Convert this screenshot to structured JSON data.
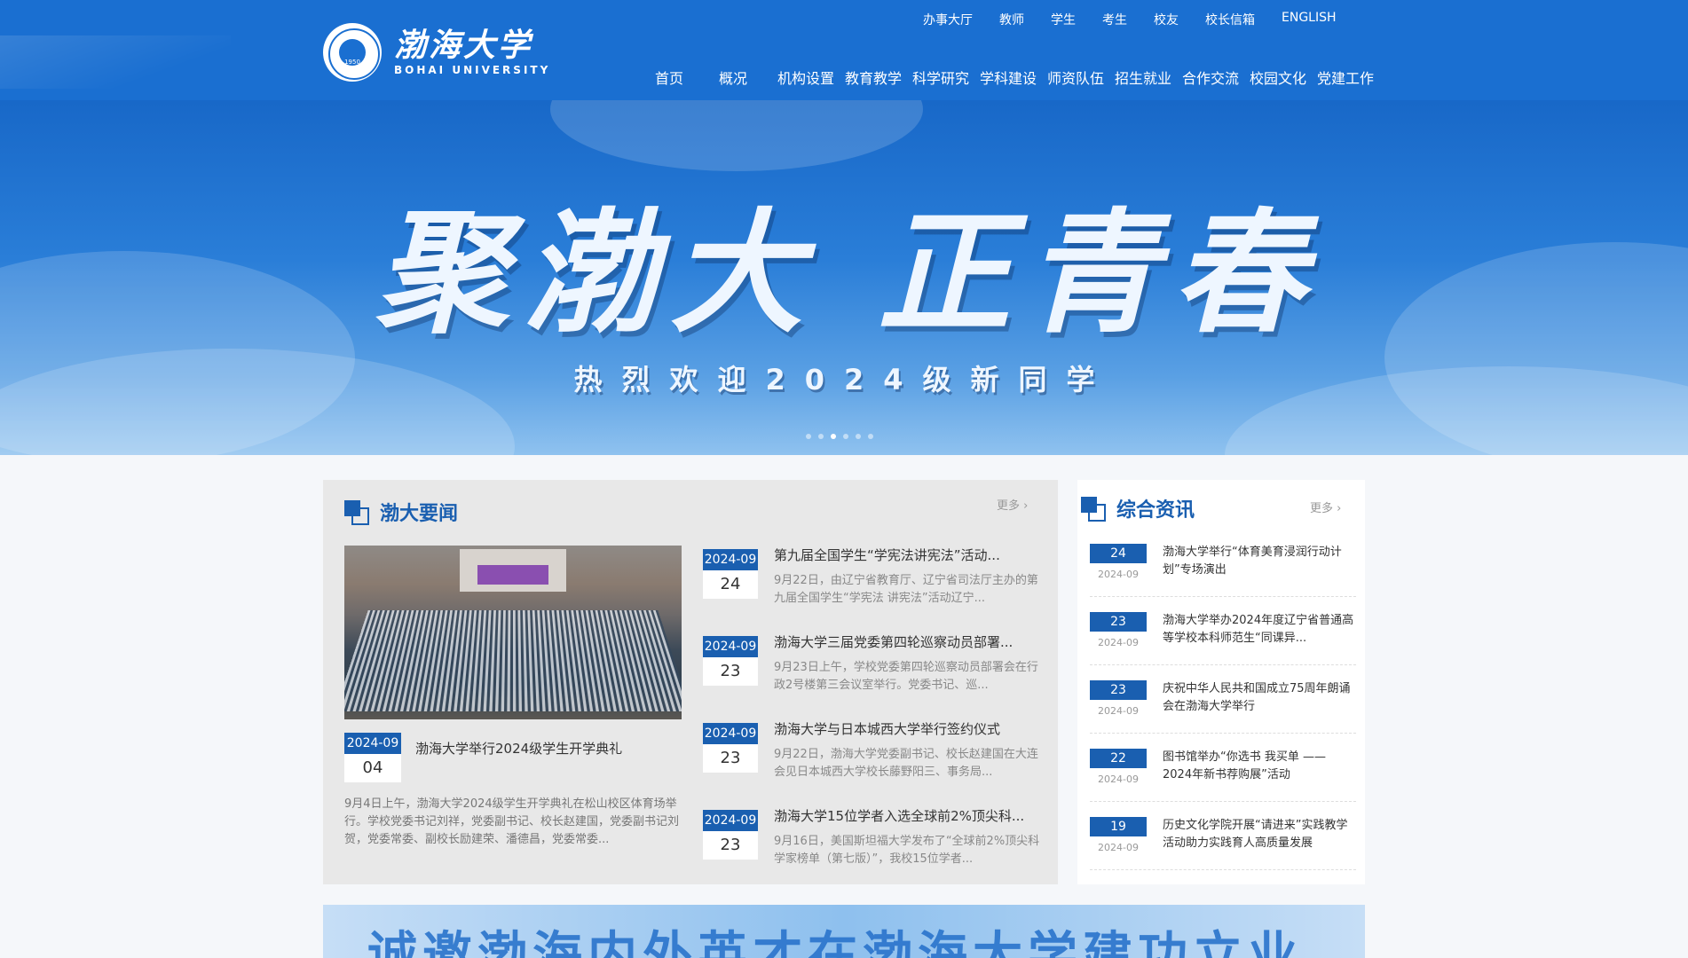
{
  "header": {
    "logo_cn": "渤海大学",
    "logo_en": "BOHAI UNIVERSITY",
    "seal_year": "1950",
    "top_links": [
      "办事大厅",
      "教师",
      "学生",
      "考生",
      "校友",
      "校长信箱",
      "ENGLISH"
    ],
    "main_nav": [
      "首页",
      "概况",
      "机构设置",
      "教育教学",
      "科学研究",
      "学科建设",
      "师资队伍",
      "招生就业",
      "合作交流",
      "校园文化",
      "党建工作"
    ]
  },
  "banner": {
    "title": "聚渤大 正青春",
    "subtitle": "热烈欢迎2024级新同学",
    "slides": 6,
    "active_slide": 3
  },
  "news": {
    "title": "渤大要闻",
    "more": "更多",
    "feature": {
      "date_ym": "2024-09",
      "date_d": "04",
      "title": "渤海大学举行2024级学生开学典礼",
      "desc": "9月4日上午，渤海大学2024级学生开学典礼在松山校区体育场举行。学校党委书记刘祥，党委副书记、校长赵建国，党委副书记刘贺，党委常委、副校长励建荣、潘德昌，党委常委..."
    },
    "items": [
      {
        "date_ym": "2024-09",
        "date_d": "24",
        "title": "第九届全国学生“学宪法讲宪法”活动...",
        "desc": "9月22日，由辽宁省教育厅、辽宁省司法厅主办的第九届全国学生“学宪法 讲宪法”活动辽宁..."
      },
      {
        "date_ym": "2024-09",
        "date_d": "23",
        "title": "渤海大学三届党委第四轮巡察动员部署...",
        "desc": "9月23日上午，学校党委第四轮巡察动员部署会在行政2号楼第三会议室举行。党委书记、巡..."
      },
      {
        "date_ym": "2024-09",
        "date_d": "23",
        "title": "渤海大学与日本城西大学举行签约仪式",
        "desc": "9月22日，渤海大学党委副书记、校长赵建国在大连会见日本城西大学校长藤野阳三、事务局..."
      },
      {
        "date_ym": "2024-09",
        "date_d": "23",
        "title": "渤海大学15位学者入选全球前2%顶尖科...",
        "desc": "9月16日，美国斯坦福大学发布了“全球前2%顶尖科学家榜单（第七版）”，我校15位学者..."
      }
    ]
  },
  "side": {
    "title": "综合资讯",
    "more": "更多",
    "items": [
      {
        "day": "24",
        "ym": "2024-09",
        "title": "渤海大学举行“体育美育浸润行动计划”专场演出"
      },
      {
        "day": "23",
        "ym": "2024-09",
        "title": "渤海大学举办2024年度辽宁省普通高等学校本科师范生“同课异..."
      },
      {
        "day": "23",
        "ym": "2024-09",
        "title": "庆祝中华人民共和国成立75周年朗诵会在渤海大学举行"
      },
      {
        "day": "22",
        "ym": "2024-09",
        "title": "图书馆举办“你选书 我买单 —— 2024年新书荐购展”活动"
      },
      {
        "day": "19",
        "ym": "2024-09",
        "title": "历史文化学院开展“请进来”实践教学活动助力实践育人高质量发展"
      }
    ]
  },
  "bottom_banner": {
    "text": "诚邀渤海内外英才在渤海大学建功立业"
  },
  "colors": {
    "header": "#1a6fd1",
    "accent": "#1a5fb0"
  }
}
